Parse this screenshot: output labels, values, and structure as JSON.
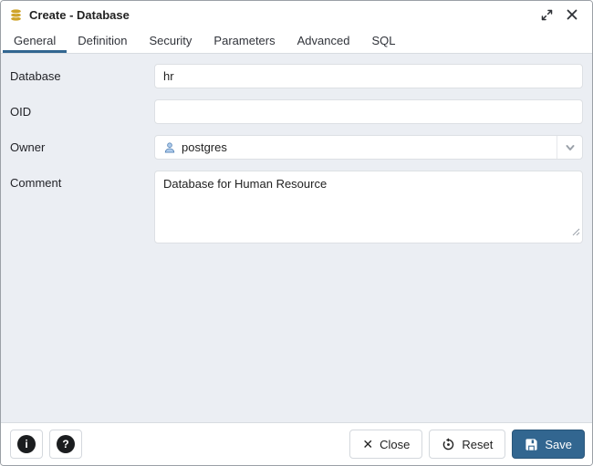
{
  "window": {
    "title": "Create - Database"
  },
  "tabs": [
    {
      "label": "General",
      "active": true
    },
    {
      "label": "Definition",
      "active": false
    },
    {
      "label": "Security",
      "active": false
    },
    {
      "label": "Parameters",
      "active": false
    },
    {
      "label": "Advanced",
      "active": false
    },
    {
      "label": "SQL",
      "active": false
    }
  ],
  "form": {
    "database": {
      "label": "Database",
      "value": "hr"
    },
    "oid": {
      "label": "OID",
      "value": ""
    },
    "owner": {
      "label": "Owner",
      "value": "postgres"
    },
    "comment": {
      "label": "Comment",
      "value": "Database for Human Resource"
    }
  },
  "footer": {
    "info_glyph": "i",
    "help_glyph": "?",
    "close_label": "Close",
    "reset_label": "Reset",
    "save_label": "Save",
    "close_glyph": "✕"
  },
  "colors": {
    "primary": "#326690",
    "form_background": "#ebeef3",
    "database_icon_gold": "#cfa42b",
    "owner_icon_blue": "#aecbeb"
  }
}
